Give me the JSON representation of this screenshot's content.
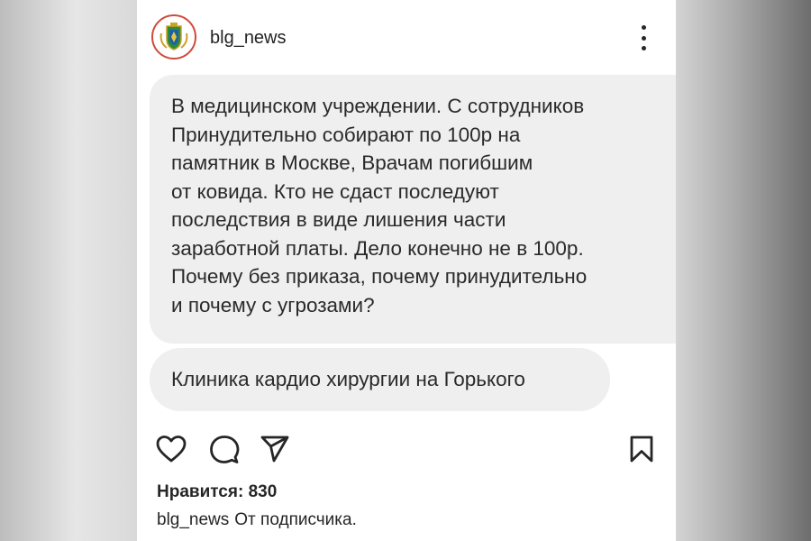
{
  "post": {
    "username": "blg_news",
    "message_lines": [
      "В медицинском учреждении. С сотрудников",
      "Принудительно собирают по 100р на",
      "памятник в Москве, Врачам погибшим",
      "от ковида. Кто не сдаст последуют",
      "последствия в виде лишения части",
      "заработной платы. Дело конечно не в 100р.",
      "Почему без приказа, почему принудительно",
      "и почему с угрозами?"
    ],
    "second_message": "Клиника кардио хирургии на Горького",
    "likes_text": "Нравится: 830",
    "caption_user": "blg_news",
    "caption_text": "От подписчика."
  },
  "icons": [
    "emblem-avatar-icon",
    "more-options-icon",
    "like-heart-icon",
    "comment-icon",
    "share-send-icon",
    "bookmark-icon"
  ],
  "colors": {
    "bubble": "#efefef",
    "avatar_ring": "#d04a3a",
    "text": "#262626"
  }
}
